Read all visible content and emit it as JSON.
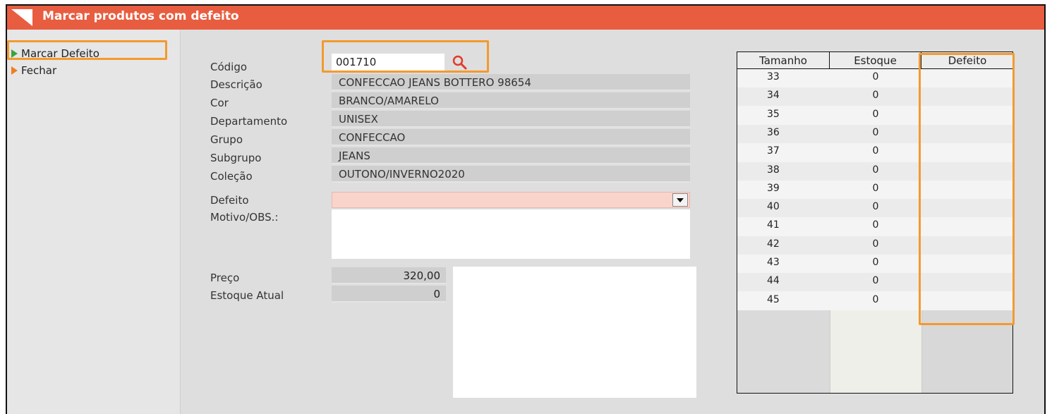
{
  "window": {
    "title": "Marcar produtos com defeito",
    "title_color": "#e85d40"
  },
  "sidebar": {
    "items": [
      {
        "label": "Marcar Defeito",
        "accel": "M",
        "rest": "arcar Defeito",
        "icon": "play-green-icon"
      },
      {
        "label": "Fechar",
        "icon": "play-orange-icon"
      }
    ]
  },
  "form": {
    "labels": {
      "codigo": "Código",
      "descricao": "Descrição",
      "cor": "Cor",
      "departamento": "Departamento",
      "grupo": "Grupo",
      "subgrupo": "Subgrupo",
      "colecao": "Coleção",
      "defeito": "Defeito",
      "motivo": "Motivo/OBS.:",
      "preco": "Preço",
      "estoque_atual": "Estoque Atual"
    },
    "values": {
      "codigo": "001710",
      "descricao": "CONFECCAO JEANS BOTTERO 98654",
      "cor": "BRANCO/AMARELO",
      "departamento": "UNISEX",
      "grupo": "CONFECCAO",
      "subgrupo": "JEANS",
      "colecao": "OUTONO/INVERNO2020",
      "defeito": "",
      "motivo": "",
      "preco": "320,00",
      "estoque_atual": "0"
    }
  },
  "grid": {
    "headers": [
      "Tamanho",
      "Estoque",
      "Defeito"
    ],
    "rows": [
      {
        "tamanho": "33",
        "estoque": "0",
        "defeito": ""
      },
      {
        "tamanho": "34",
        "estoque": "0",
        "defeito": ""
      },
      {
        "tamanho": "35",
        "estoque": "0",
        "defeito": ""
      },
      {
        "tamanho": "36",
        "estoque": "0",
        "defeito": ""
      },
      {
        "tamanho": "37",
        "estoque": "0",
        "defeito": ""
      },
      {
        "tamanho": "38",
        "estoque": "0",
        "defeito": ""
      },
      {
        "tamanho": "39",
        "estoque": "0",
        "defeito": ""
      },
      {
        "tamanho": "40",
        "estoque": "0",
        "defeito": ""
      },
      {
        "tamanho": "41",
        "estoque": "0",
        "defeito": ""
      },
      {
        "tamanho": "42",
        "estoque": "0",
        "defeito": ""
      },
      {
        "tamanho": "43",
        "estoque": "0",
        "defeito": ""
      },
      {
        "tamanho": "44",
        "estoque": "0",
        "defeito": ""
      },
      {
        "tamanho": "45",
        "estoque": "0",
        "defeito": ""
      }
    ]
  },
  "highlight_color": "#f39a2f"
}
